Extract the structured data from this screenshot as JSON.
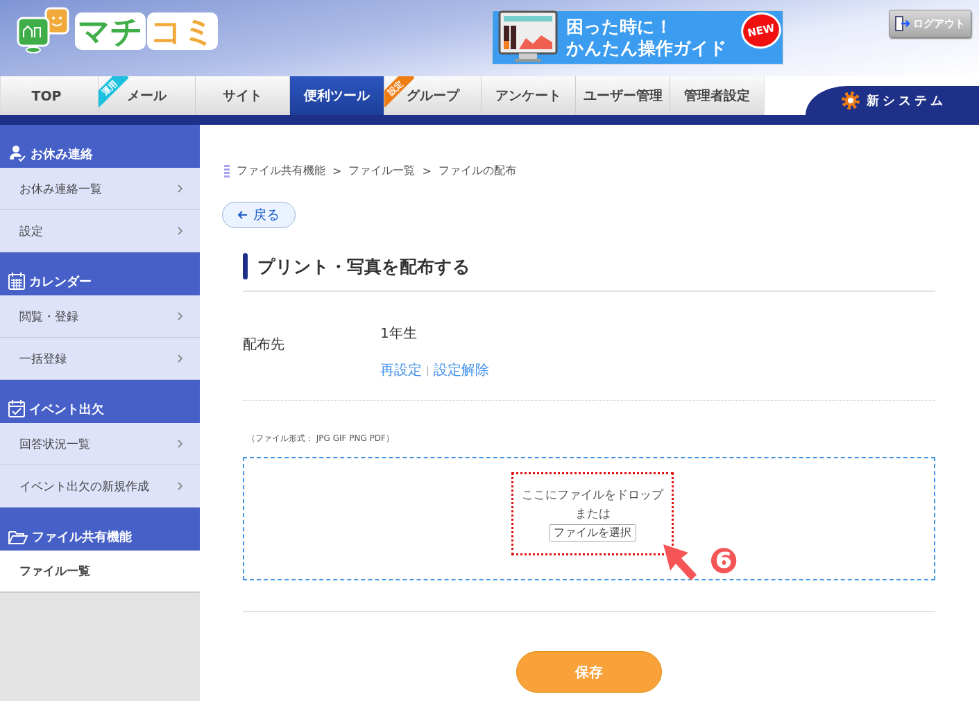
{
  "header": {
    "logo": [
      {
        "text": "マチ",
        "color": "#3fae49"
      },
      {
        "text": "コミ",
        "color": "#f2a93b"
      }
    ],
    "guide_banner": {
      "lines": [
        "困った時に！",
        "かんたん操作ガイド"
      ],
      "badge": "NEW"
    },
    "logout": "ログアウト"
  },
  "tabs": [
    {
      "label": "TOP",
      "selected": false
    },
    {
      "label": "メール",
      "selected": false,
      "corner": "運用",
      "color": "#1ec0e0"
    },
    {
      "label": "サイト",
      "selected": false
    },
    {
      "label": "便利ツール",
      "selected": true
    },
    {
      "label": "グループ",
      "selected": false,
      "corner": "設定",
      "color": "#f07d12"
    },
    {
      "label": "アンケート",
      "selected": false
    },
    {
      "label": "ユーザー管理",
      "selected": false
    },
    {
      "label": "管理者設定",
      "selected": false
    }
  ],
  "new_system": "新システム",
  "sidebar": [
    {
      "title": "お休み連絡",
      "kind": "person",
      "items": [
        {
          "label": "お休み連絡一覧",
          "selected": false
        },
        {
          "label": "設定",
          "selected": false
        }
      ]
    },
    {
      "title": "カレンダー",
      "kind": "calendar",
      "items": [
        {
          "label": "閲覧・登録",
          "selected": false
        },
        {
          "label": "一括登録",
          "selected": false
        }
      ]
    },
    {
      "title": "イベント出欠",
      "kind": "event",
      "items": [
        {
          "label": "回答状況一覧",
          "selected": false
        },
        {
          "label": "イベント出欠の新規作成",
          "selected": false
        }
      ]
    },
    {
      "title": "ファイル共有機能",
      "kind": "folder",
      "items": [
        {
          "label": "ファイル一覧",
          "selected": true
        }
      ]
    }
  ],
  "breadcrumb": [
    "ファイル共有機能",
    "ファイル一覧",
    "ファイルの配布"
  ],
  "breadcrumb_separator": ">",
  "back_button": "戻る",
  "page_title": "プリント・写真を配布する",
  "destination": {
    "label": "配布先",
    "value": "1年生",
    "links": [
      "再設定",
      "設定解除"
    ],
    "separator": "|"
  },
  "file_format_note": "（ファイル形式： JPG GIF PNG PDF）",
  "drop_zone": {
    "text": "ここにファイルをドロップ",
    "or": "または",
    "button": "ファイルを選択"
  },
  "annotation": {
    "number": "❻"
  },
  "save_button": "保存"
}
